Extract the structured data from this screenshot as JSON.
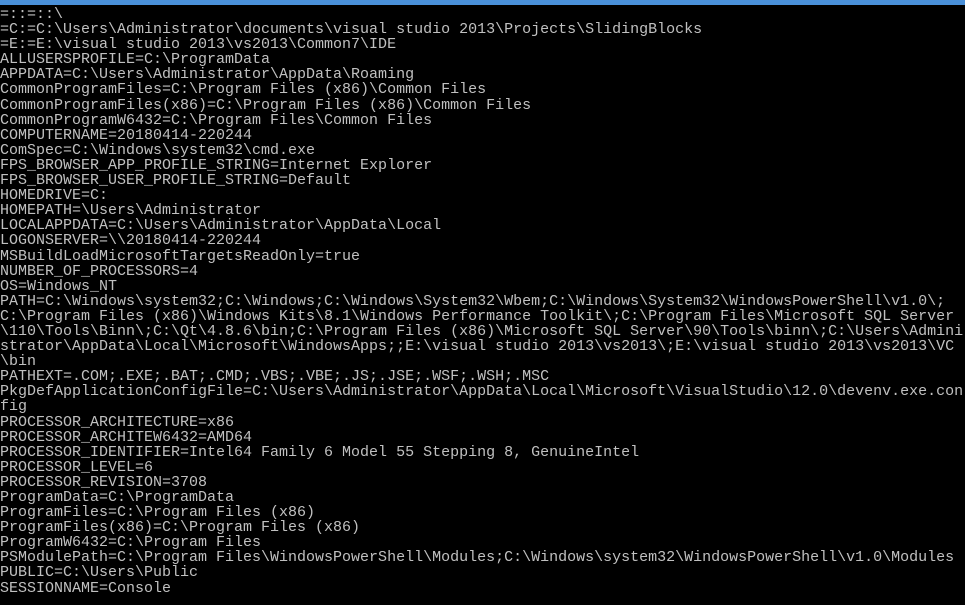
{
  "lines": [
    "=::=::\\",
    "=C:=C:\\Users\\Administrator\\documents\\visual studio 2013\\Projects\\SlidingBlocks",
    "=E:=E:\\visual studio 2013\\vs2013\\Common7\\IDE",
    "ALLUSERSPROFILE=C:\\ProgramData",
    "APPDATA=C:\\Users\\Administrator\\AppData\\Roaming",
    "CommonProgramFiles=C:\\Program Files (x86)\\Common Files",
    "CommonProgramFiles(x86)=C:\\Program Files (x86)\\Common Files",
    "CommonProgramW6432=C:\\Program Files\\Common Files",
    "COMPUTERNAME=20180414-220244",
    "ComSpec=C:\\Windows\\system32\\cmd.exe",
    "FPS_BROWSER_APP_PROFILE_STRING=Internet Explorer",
    "FPS_BROWSER_USER_PROFILE_STRING=Default",
    "HOMEDRIVE=C:",
    "HOMEPATH=\\Users\\Administrator",
    "LOCALAPPDATA=C:\\Users\\Administrator\\AppData\\Local",
    "LOGONSERVER=\\\\20180414-220244",
    "MSBuildLoadMicrosoftTargetsReadOnly=true",
    "NUMBER_OF_PROCESSORS=4",
    "OS=Windows_NT",
    "PATH=C:\\Windows\\system32;C:\\Windows;C:\\Windows\\System32\\Wbem;C:\\Windows\\System32\\WindowsPowerShell\\v1.0\\;C:\\Program Files (x86)\\Windows Kits\\8.1\\Windows Performance Toolkit\\;C:\\Program Files\\Microsoft SQL Server\\110\\Tools\\Binn\\;C:\\Qt\\4.8.6\\bin;C:\\Program Files (x86)\\Microsoft SQL Server\\90\\Tools\\binn\\;C:\\Users\\Administrator\\AppData\\Local\\Microsoft\\WindowsApps;;E:\\visual studio 2013\\vs2013\\;E:\\visual studio 2013\\vs2013\\VC\\bin",
    "PATHEXT=.COM;.EXE;.BAT;.CMD;.VBS;.VBE;.JS;.JSE;.WSF;.WSH;.MSC",
    "PkgDefApplicationConfigFile=C:\\Users\\Administrator\\AppData\\Local\\Microsoft\\VisualStudio\\12.0\\devenv.exe.config",
    "PROCESSOR_ARCHITECTURE=x86",
    "PROCESSOR_ARCHITEW6432=AMD64",
    "PROCESSOR_IDENTIFIER=Intel64 Family 6 Model 55 Stepping 8, GenuineIntel",
    "PROCESSOR_LEVEL=6",
    "PROCESSOR_REVISION=3708",
    "ProgramData=C:\\ProgramData",
    "ProgramFiles=C:\\Program Files (x86)",
    "ProgramFiles(x86)=C:\\Program Files (x86)",
    "ProgramW6432=C:\\Program Files",
    "PSModulePath=C:\\Program Files\\WindowsPowerShell\\Modules;C:\\Windows\\system32\\WindowsPowerShell\\v1.0\\Modules",
    "PUBLIC=C:\\Users\\Public",
    "",
    "SESSIONNAME=Console"
  ]
}
